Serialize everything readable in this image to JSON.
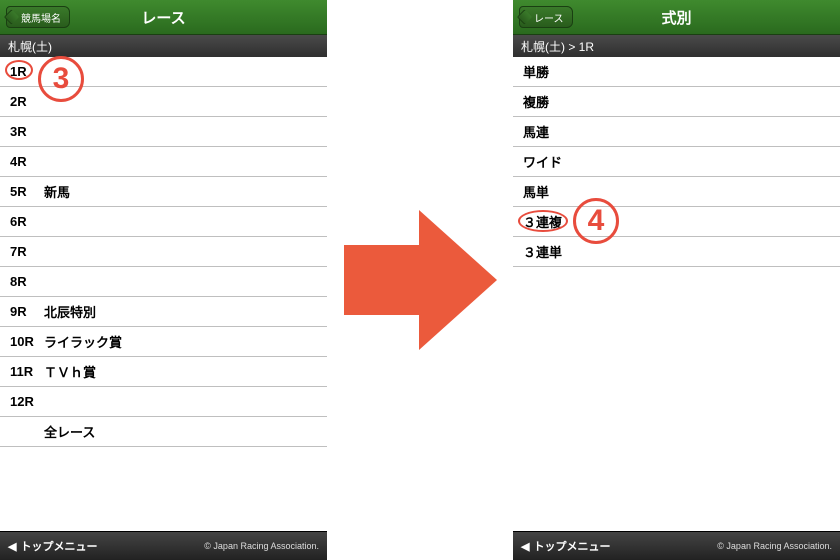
{
  "screen_left": {
    "back_label": "競馬場名",
    "title": "レース",
    "breadcrumb": "札幌(土)",
    "rows": [
      {
        "rn": "1R",
        "name": ""
      },
      {
        "rn": "2R",
        "name": ""
      },
      {
        "rn": "3R",
        "name": ""
      },
      {
        "rn": "4R",
        "name": ""
      },
      {
        "rn": "5R",
        "name": "新馬"
      },
      {
        "rn": "6R",
        "name": ""
      },
      {
        "rn": "7R",
        "name": ""
      },
      {
        "rn": "8R",
        "name": ""
      },
      {
        "rn": "9R",
        "name": "北辰特別"
      },
      {
        "rn": "10R",
        "name": "ライラック賞"
      },
      {
        "rn": "11R",
        "name": "ＴＶｈ賞"
      },
      {
        "rn": "12R",
        "name": ""
      },
      {
        "rn": "",
        "name": "全レース"
      }
    ],
    "footer_left": "トップメニュー",
    "footer_right": "© Japan Racing Association."
  },
  "screen_right": {
    "back_label": "レース",
    "title": "式別",
    "breadcrumb": "札幌(土) > 1R",
    "rows": [
      {
        "label": "単勝"
      },
      {
        "label": "複勝"
      },
      {
        "label": "馬連"
      },
      {
        "label": "ワイド"
      },
      {
        "label": "馬単"
      },
      {
        "label": "３連複"
      },
      {
        "label": "３連単"
      }
    ],
    "footer_left": "トップメニュー",
    "footer_right": "© Japan Racing Association."
  },
  "callouts": {
    "c3": "3",
    "c4": "4"
  }
}
